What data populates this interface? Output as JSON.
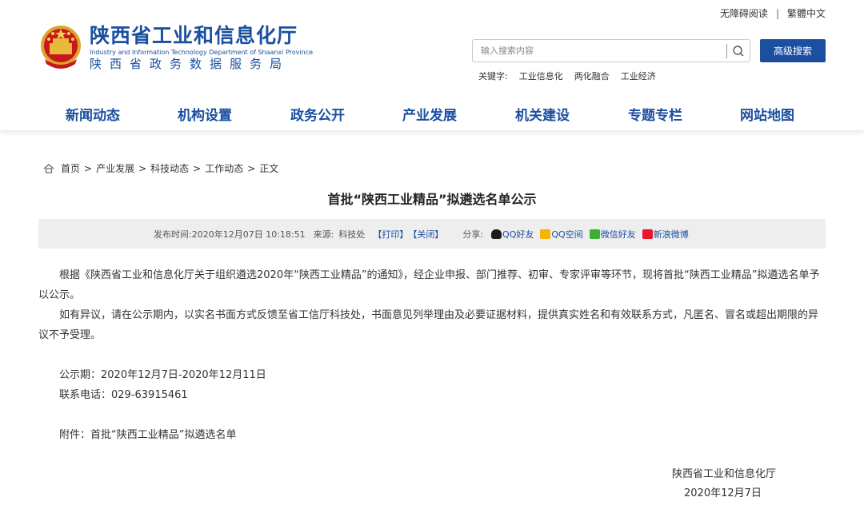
{
  "topbar": {
    "accessibility": "无障碍阅读",
    "separator": "|",
    "traditional": "繁體中文"
  },
  "logo": {
    "name_cn": "陕西省工业和信息化厅",
    "name_en": "Industry and Information Technology Department of Shaanxi Province",
    "subtitle": "陕西省政务数据服务局"
  },
  "search": {
    "placeholder": "输入搜索内容",
    "advanced_label": "高级搜索"
  },
  "keywords": {
    "label": "关键字:",
    "items": [
      "工业信息化",
      "两化融合",
      "工业经济"
    ]
  },
  "nav": {
    "items": [
      "新闻动态",
      "机构设置",
      "政务公开",
      "产业发展",
      "机关建设",
      "专题专栏",
      "网站地图"
    ]
  },
  "breadcrumb": {
    "items": [
      "首页",
      "产业发展",
      "科技动态",
      "工作动态",
      "正文"
    ],
    "arrow": ">"
  },
  "article": {
    "title": "首批“陕西工业精品”拟遴选名单公示",
    "meta": {
      "publish_label": "发布时间:",
      "publish_time": "2020年12月07日 10:18:51",
      "source_label": "来源:",
      "source": "科技处",
      "print": "【打印】",
      "close": "【关闭】",
      "share_label": "分享:",
      "share": [
        "QQ好友",
        "QQ空间",
        "微信好友",
        "新浪微博"
      ]
    },
    "paragraph1": "根据《陕西省工业和信息化厅关于组织遴选2020年“陕西工业精品”的通知》，经企业申报、部门推荐、初审、专家评审等环节，现将首批“陕西工业精品”拟遴选名单予以公示。",
    "paragraph2": "如有异议，请在公示期内，以实名书面方式反馈至省工信厅科技处，书面意见列举理由及必要证据材料，提供真实姓名和有效联系方式，凡匿名、冒名或超出期限的异议不予受理。",
    "period": "公示期：2020年12月7日-2020年12月11日",
    "phone": "联系电话：029-63915461",
    "attachment": "附件：首批“陕西工业精品”拟遴选名单",
    "signature_org": "陕西省工业和信息化厅",
    "signature_date": "2020年12月7日"
  },
  "colors": {
    "brand_blue": "#1b4fa0",
    "meta_bg": "#eeeeee"
  }
}
